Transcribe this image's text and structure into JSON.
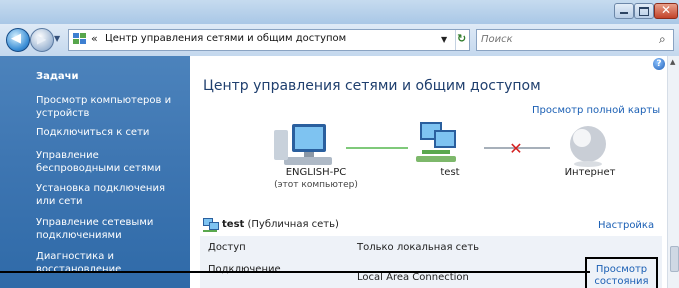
{
  "window": {
    "title": ""
  },
  "address": {
    "chevron": "«",
    "path": "Центр управления сетями и общим доступом"
  },
  "search": {
    "placeholder": "Поиск"
  },
  "sidebar": {
    "heading": "Задачи",
    "items": [
      {
        "label": "Просмотр компьютеров и устройств"
      },
      {
        "label": "Подключиться к сети"
      },
      {
        "label": "Управление беспроводными сетями"
      },
      {
        "label": "Установка подключения или сети"
      },
      {
        "label": "Управление сетевыми подключениями"
      },
      {
        "label": "Диагностика и восстановление"
      }
    ]
  },
  "main": {
    "page_title": "Центр управления сетями и общим доступом",
    "full_map_link": "Просмотр полной карты",
    "map": {
      "computer_name": "ENGLISH-PC",
      "computer_sub": "(этот компьютер)",
      "network_name": "test",
      "internet_label": "Интернет"
    },
    "network": {
      "name": "test",
      "type": "(Публичная сеть)",
      "customize_link": "Настройка",
      "rows": [
        {
          "label": "Доступ",
          "value": "Только локальная сеть"
        },
        {
          "label": "Подключение",
          "value": "Local Area Connection"
        }
      ],
      "view_status_line1": "Просмотр",
      "view_status_line2": "состояния"
    }
  },
  "colors": {
    "sidebar": "#3e76b2",
    "link": "#1a5fb4",
    "green_link": "#7fc97a",
    "error_x": "#d42020"
  }
}
